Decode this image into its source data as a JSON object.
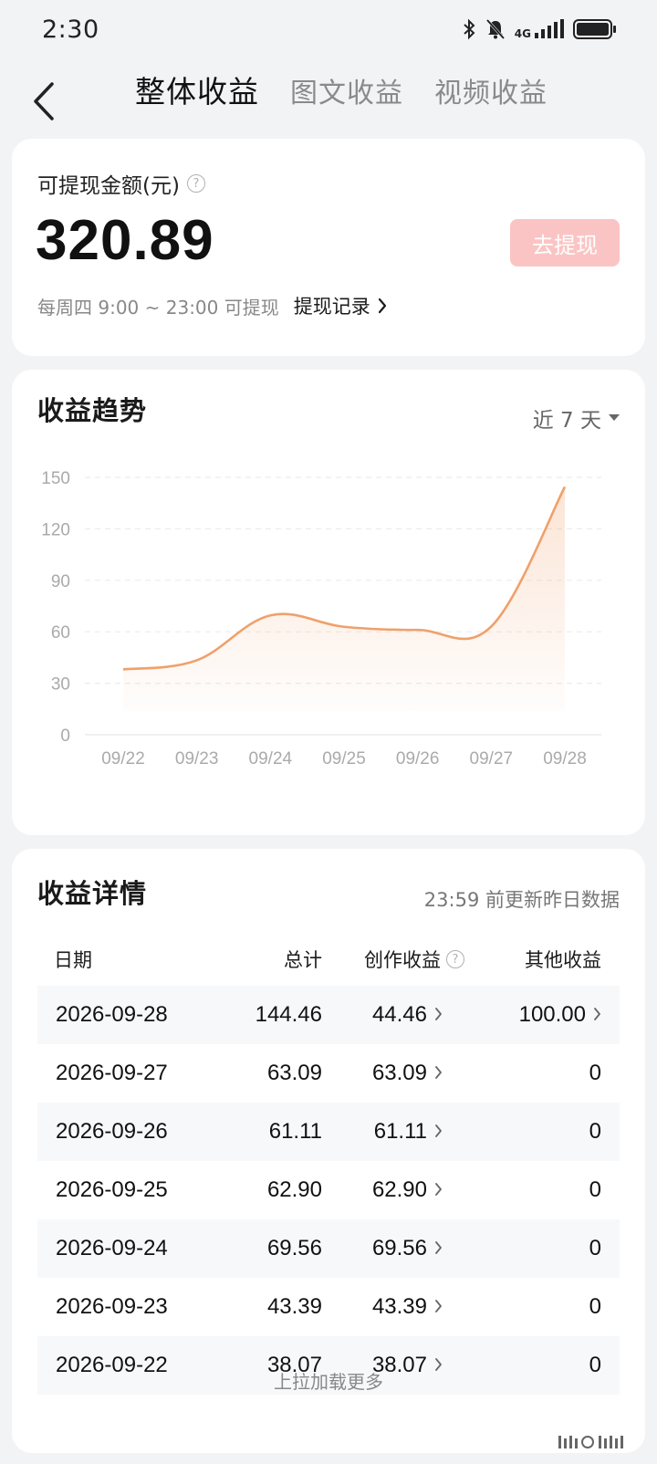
{
  "status_bar": {
    "time": "2:30",
    "network": "4G",
    "icons": [
      "bluetooth-icon",
      "mute-bell-icon",
      "signal-icon",
      "battery-icon"
    ]
  },
  "nav": {
    "tabs": [
      {
        "label": "整体收益",
        "active": true
      },
      {
        "label": "图文收益",
        "active": false
      },
      {
        "label": "视频收益",
        "active": false
      }
    ]
  },
  "balance": {
    "label": "可提现金额(元)",
    "amount": "320.89",
    "withdraw_button": "去提现",
    "note": "每周四 9:00 ~ 23:00 可提现",
    "record_link": "提现记录"
  },
  "trend": {
    "title": "收益趋势",
    "range": "近 7 天"
  },
  "chart_data": {
    "type": "area",
    "categories": [
      "09/22",
      "09/23",
      "09/24",
      "09/25",
      "09/26",
      "09/27",
      "09/28"
    ],
    "values": [
      38.07,
      43.39,
      69.56,
      62.9,
      61.11,
      63.09,
      144.46
    ],
    "yticks": [
      0,
      30,
      60,
      90,
      120,
      150
    ],
    "ylim": [
      0,
      150
    ],
    "grid": true,
    "color": "#f0a06a"
  },
  "detail": {
    "title": "收益详情",
    "update_note": "23:59 前更新昨日数据",
    "columns": {
      "date": "日期",
      "total": "总计",
      "create": "创作收益",
      "other": "其他收益"
    },
    "rows": [
      {
        "date": "2026-09-28",
        "total": "144.46",
        "create": "44.46",
        "other": "100.00",
        "other_link": true
      },
      {
        "date": "2026-09-27",
        "total": "63.09",
        "create": "63.09",
        "other": "0",
        "other_link": false
      },
      {
        "date": "2026-09-26",
        "total": "61.11",
        "create": "61.11",
        "other": "0",
        "other_link": false
      },
      {
        "date": "2026-09-25",
        "total": "62.90",
        "create": "62.90",
        "other": "0",
        "other_link": false
      },
      {
        "date": "2026-09-24",
        "total": "69.56",
        "create": "69.56",
        "other": "0",
        "other_link": false
      },
      {
        "date": "2026-09-23",
        "total": "43.39",
        "create": "43.39",
        "other": "0",
        "other_link": false
      },
      {
        "date": "2026-09-22",
        "total": "38.07",
        "create": "38.07",
        "other": "0",
        "other_link": false
      }
    ],
    "load_more": "上拉加载更多"
  }
}
